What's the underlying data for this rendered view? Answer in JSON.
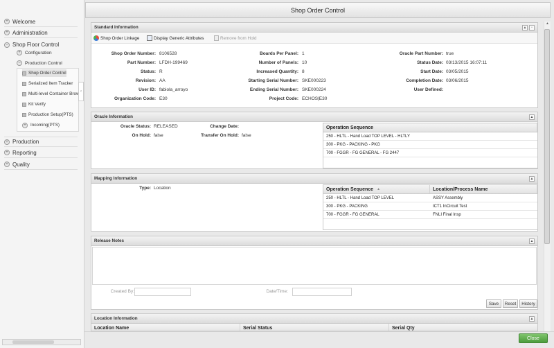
{
  "window": {
    "title": "Shop Floor Control"
  },
  "sidebar": {
    "top_items": [
      "Welcome",
      "Administration",
      "Shop Floor Control"
    ],
    "sub_items": [
      "Configuration",
      "Production Control"
    ],
    "tree_items": [
      "Shop Order Control",
      "Serialized Item Tracker",
      "Multi-level Container Brow",
      "Kit Verify",
      "Production Setup(PTS)",
      "Incoming(PTS)"
    ],
    "bottom_items": [
      "Production",
      "Reporting",
      "Quality"
    ]
  },
  "titlebar": {
    "title": "Shop Order Control"
  },
  "standard": {
    "header": "Standard Information",
    "toolbar": {
      "linkage": "Shop Order Linkage",
      "display_generic": "Display Generic Attributes",
      "remove_hold": "Remove from Hold"
    },
    "labels": {
      "shop_order_number": "Shop Order Number:",
      "part_number": "Part Number:",
      "status": "Status:",
      "revision": "Revision:",
      "user_id": "User ID:",
      "org_code": "Organization Code:",
      "boards_per_panel": "Boards Per Panel:",
      "number_of_panels": "Number of Panels:",
      "increased_qty": "Increased Quantity:",
      "starting_serial": "Starting Serial Number:",
      "ending_serial": "Ending Serial Number:",
      "project_code": "Project Code:",
      "oracle_part_number": "Oracle Part Number:",
      "status_date": "Status Date:",
      "start_date": "Start Date:",
      "completion_date": "Completion Date:",
      "user_defined": "User Defined:"
    },
    "values": {
      "shop_order_number": "8106528",
      "part_number": "LFDH-199469",
      "status": "R",
      "revision": "AA",
      "user_id": "fabiola_arroyo",
      "org_code": "E30",
      "boards_per_panel": "1",
      "number_of_panels": "10",
      "increased_qty": "8",
      "starting_serial": "SKE000223",
      "ending_serial": "SKE000224",
      "project_code": "ECHOS|E30",
      "oracle_part_number": "true",
      "status_date": "03/13/2015 16:07:11",
      "start_date": "03/05/2015",
      "completion_date": "03/06/2015",
      "user_defined": ""
    }
  },
  "oracle": {
    "header": "Oracle Information",
    "labels": {
      "oracle_status": "Oracle Status:",
      "on_hold": "On Hold:",
      "change_date": "Change Date:",
      "transfer_on_hold": "Transfer On Hold:"
    },
    "values": {
      "oracle_status": "RELEASED",
      "on_hold": "false",
      "change_date": "",
      "transfer_on_hold": "false"
    },
    "grid": {
      "columns": [
        "Operation Sequence"
      ],
      "rows": [
        "250 - HLTL - Hand Load TOP LEVEL - HLTLY",
        "300 - PKG - PACKING - PKG",
        "700 - FGGR - FG GENERAL - FG 2447"
      ]
    }
  },
  "mapping": {
    "header": "Mapping Information",
    "labels": {
      "type": "Type:"
    },
    "values": {
      "type": "Location"
    },
    "grid": {
      "columns": [
        "Operation Sequence",
        "Location/Process Name"
      ],
      "rows": [
        [
          "250 - HLTL - Hand Load TOP LEVEL",
          "ASSY Assembly"
        ],
        [
          "300 - PKG - PACKING",
          "ICT1 InCircuit Test"
        ],
        [
          "700 - FGGR - FG GENERAL",
          "FNLI Final Insp"
        ]
      ]
    }
  },
  "release": {
    "header": "Release Notes",
    "labels": {
      "created_by": "Created By:",
      "date_time": "Date/Time:"
    },
    "buttons": {
      "save": "Save",
      "reset": "Reset",
      "history": "History"
    }
  },
  "location": {
    "header": "Location Information",
    "columns": [
      "Location Name",
      "Serial Status",
      "Serial Qty"
    ]
  },
  "footer": {
    "close": "Close"
  },
  "colors": {
    "close_button": "#5aa847"
  }
}
